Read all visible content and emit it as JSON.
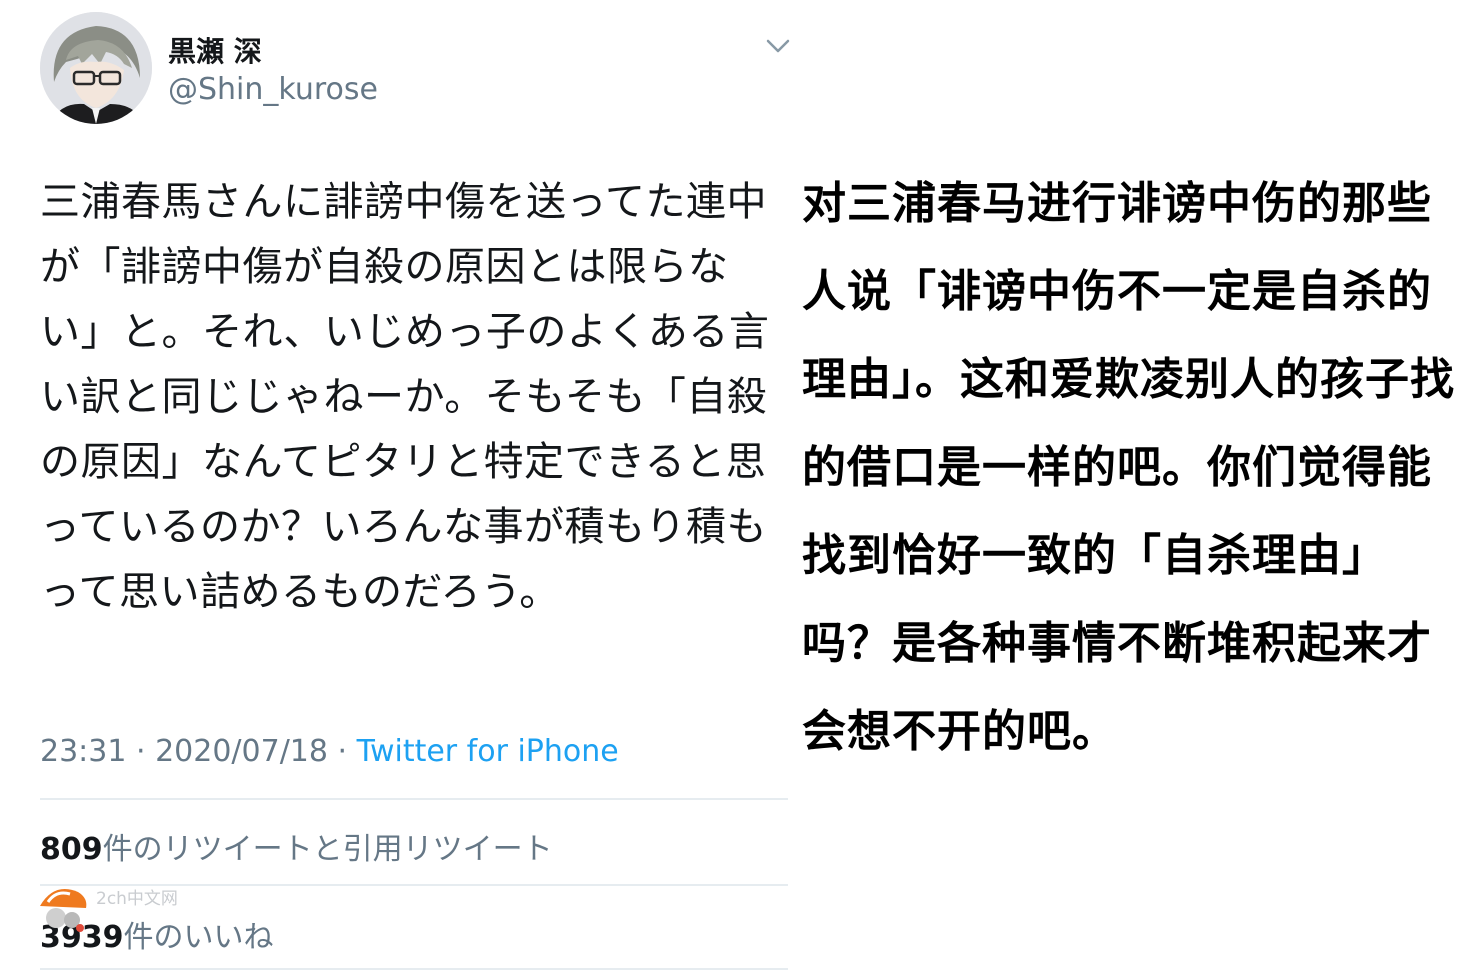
{
  "tweet": {
    "display_name": "黒瀬 深",
    "handle": "@Shin_kurose",
    "body": "三浦春馬さんに誹謗中傷を送ってた連中が「誹謗中傷が自殺の原因とは限らない」と。それ、いじめっ子のよくある言い訳と同じじゃねーか。そもそも「自殺の原因」なんてピタリと特定できると思っているのか？いろんな事が積もり積もって思い詰めるものだろう。",
    "time": "23:31 · 2020/07/18 · ",
    "source": "Twitter for iPhone",
    "retweets": {
      "count": "809",
      "label": "件のリツイートと引用リツイート"
    },
    "likes": {
      "count": "3939",
      "label": "件のいいね"
    }
  },
  "translation": "对三浦春马进行诽谤中伤的那些人说「诽谤中伤不一定是自杀的理由」。这和爱欺凌别人的孩子找的借口是一样的吧。你们觉得能找到恰好一致的「自杀理由」吗？是各种事情不断堆积起来才会想不开的吧。",
  "watermark": {
    "text": "2ch中文网"
  },
  "colors": {
    "text": "#14171a",
    "secondary": "#657786",
    "link": "#1da1f2",
    "divider": "#e6ecf0"
  },
  "icons": {
    "menu": "chevron-down-icon",
    "avatar": "user-avatar"
  }
}
